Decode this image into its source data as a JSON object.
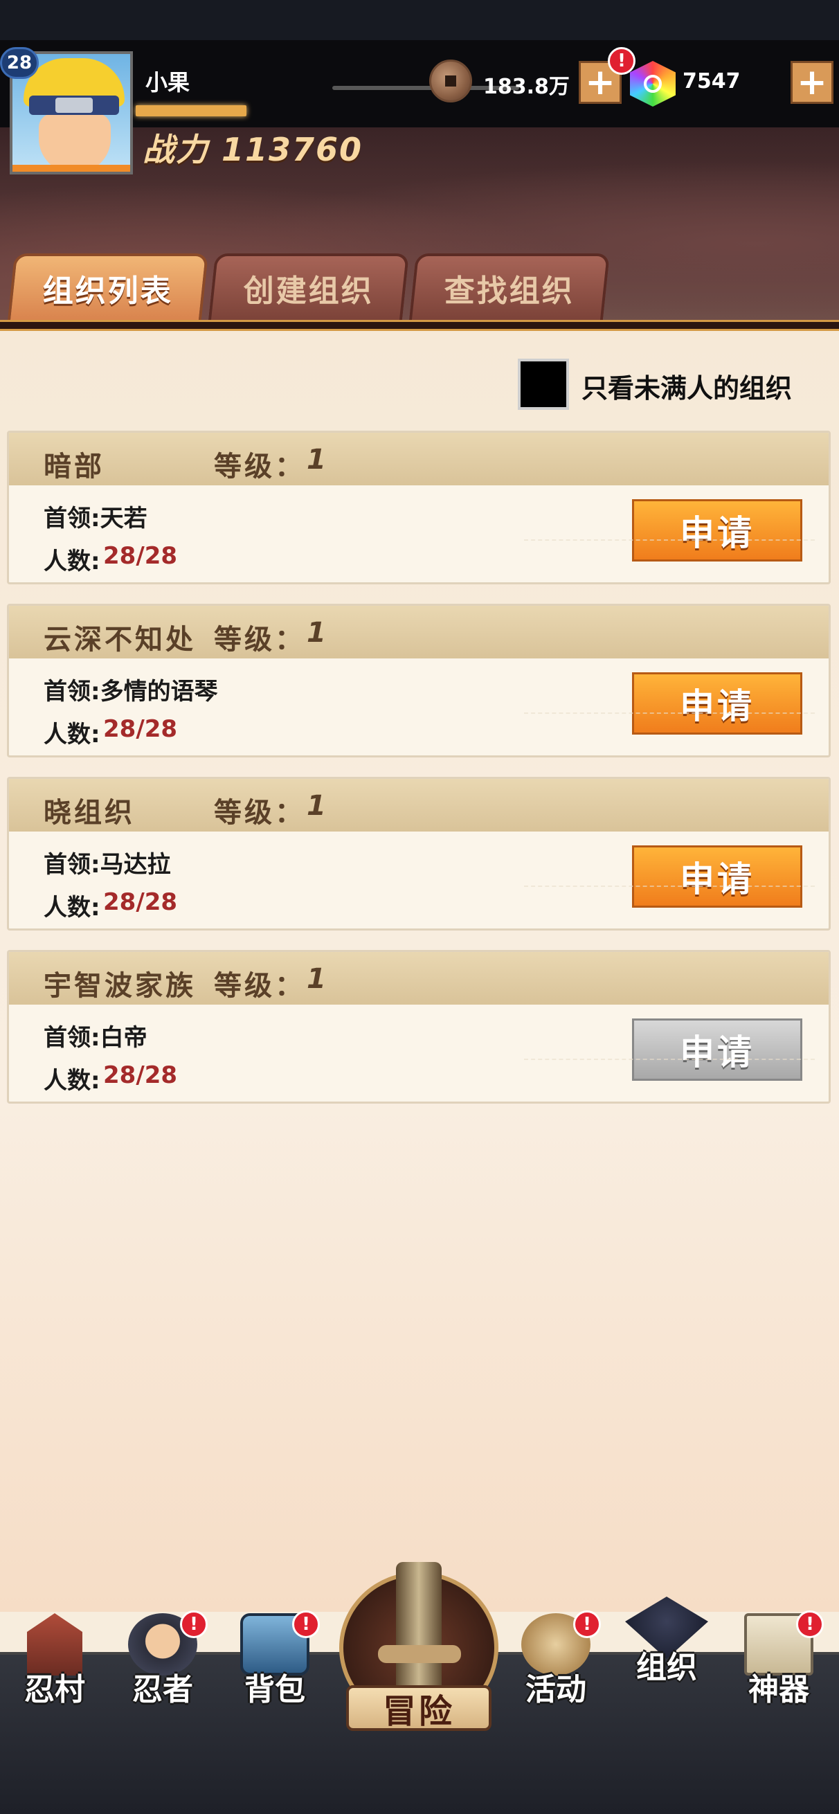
{
  "player": {
    "level": "28",
    "name": "小果",
    "power": "战力 113760"
  },
  "currency": {
    "coins": "183.8万",
    "coins_plus": "+",
    "coins_alert": "!",
    "gems": "7547",
    "gems_plus": "+"
  },
  "tabs": [
    {
      "label": "组织列表",
      "active": true
    },
    {
      "label": "创建组织",
      "active": false
    },
    {
      "label": "查找组织",
      "active": false
    }
  ],
  "filter": {
    "label": "只看未满人的组织",
    "checked": false
  },
  "labels": {
    "level_prefix": "等级：",
    "members_prefix": "人数:",
    "apply": "申请"
  },
  "organizations": [
    {
      "name": "暗部",
      "level": "1",
      "leader": "首领:天若",
      "members": "28/28",
      "can_apply": true
    },
    {
      "name": "云深不知处",
      "level": "1",
      "leader": "首领:多情的语琴",
      "members": "28/28",
      "can_apply": true
    },
    {
      "name": "晓组织",
      "level": "1",
      "leader": "首领:马达拉",
      "members": "28/28",
      "can_apply": true
    },
    {
      "name": "宇智波家族",
      "level": "1",
      "leader": "首领:白帝",
      "members": "28/28",
      "can_apply": false
    }
  ],
  "bottom_nav": {
    "village": {
      "label": "忍村",
      "alert": ""
    },
    "ninja": {
      "label": "忍者",
      "alert": "!"
    },
    "bag": {
      "label": "背包",
      "alert": "!"
    },
    "adventure": {
      "label": "冒险"
    },
    "activity": {
      "label": "活动",
      "alert": "!"
    },
    "organization": {
      "label": "组织",
      "alert": ""
    },
    "artifact": {
      "label": "神器",
      "alert": "!"
    }
  },
  "colors": {
    "accent_orange": "#f07d1c",
    "member_count_red": "#a42a2a",
    "alert_red": "#e02030"
  }
}
